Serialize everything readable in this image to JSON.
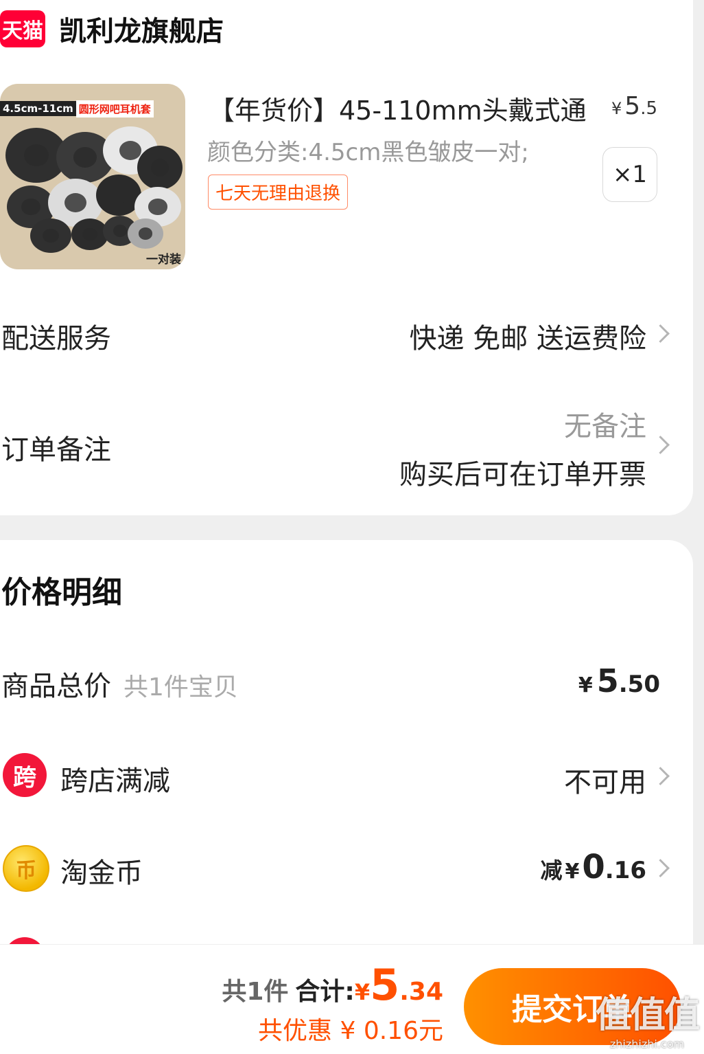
{
  "shop": {
    "badge": "天猫",
    "name": "凯利龙旗舰店"
  },
  "product": {
    "image_banner_left": "4.5cm-11cm",
    "image_banner_right": "圆形网吧耳机套",
    "image_tag": "一对装",
    "title": "【年货价】45-110mm头戴式通",
    "price_yen": "¥",
    "price_int": "5",
    "price_dec": ".5",
    "sku": "颜色分类:4.5cm黑色皱皮一对;",
    "return_tag": "七天无理由退换",
    "quantity": "×1"
  },
  "delivery": {
    "label": "配送服务",
    "value": "快递 免邮 送运费险"
  },
  "remark": {
    "label": "订单备注",
    "placeholder": "无备注",
    "note": "购买后可在订单开票"
  },
  "price_detail": {
    "title": "价格明细",
    "goods_total_label": "商品总价",
    "goods_total_sub": "共1件宝贝",
    "goods_total_yen": "¥",
    "goods_total_int": "5",
    "goods_total_dec": ".50",
    "cross_store_icon": "跨",
    "cross_store_label": "跨店满减",
    "cross_store_value": "不可用",
    "coin_icon": "币",
    "coin_label": "淘金币",
    "coin_prefix": "减",
    "coin_yen": "¥",
    "coin_int": "0",
    "coin_dec": ".16"
  },
  "footer": {
    "count": "共1件",
    "total_label": "合计:",
    "total_yen": "¥",
    "total_int": "5",
    "total_dec": ".34",
    "saved": "共优惠 ¥ 0.16元",
    "submit": "提交订单",
    "watermark": "值值值",
    "watermark_url": "zhizhizhi.com"
  },
  "colors": {
    "accent": "#ff5000",
    "tmall_red": "#ff0036",
    "button_gradient_start": "#ff9000",
    "button_gradient_end": "#ff5000"
  }
}
